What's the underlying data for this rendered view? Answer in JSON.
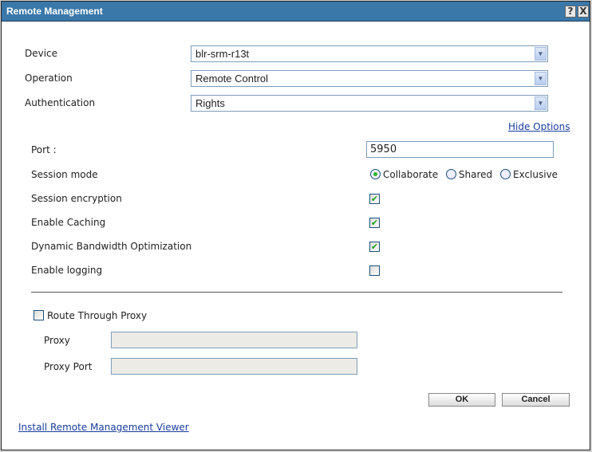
{
  "title": "Remote Management",
  "title_buttons": {
    "help": "?",
    "close": "X"
  },
  "device": {
    "label": "Device",
    "value": "blr-srm-r13t"
  },
  "operation": {
    "label": "Operation",
    "value": "Remote Control"
  },
  "authentication": {
    "label": "Authentication",
    "value": "Rights"
  },
  "hide_options": "Hide Options",
  "port": {
    "label": "Port :",
    "value": "5950"
  },
  "session_mode": {
    "label": "Session mode",
    "options": [
      "Collaborate",
      "Shared",
      "Exclusive"
    ],
    "selected": "Collaborate"
  },
  "session_encryption": {
    "label": "Session encryption",
    "checked": true
  },
  "enable_caching": {
    "label": "Enable Caching",
    "checked": true
  },
  "dynamic_bandwidth": {
    "label": "Dynamic Bandwidth Optimization",
    "checked": true
  },
  "enable_logging": {
    "label": "Enable logging",
    "checked": false
  },
  "route_proxy": {
    "label": "Route Through Proxy",
    "checked": false
  },
  "proxy": {
    "label": "Proxy",
    "value": ""
  },
  "proxy_port": {
    "label": "Proxy Port",
    "value": ""
  },
  "buttons": {
    "ok": "OK",
    "cancel": "Cancel"
  },
  "install_link": "Install Remote Management Viewer"
}
